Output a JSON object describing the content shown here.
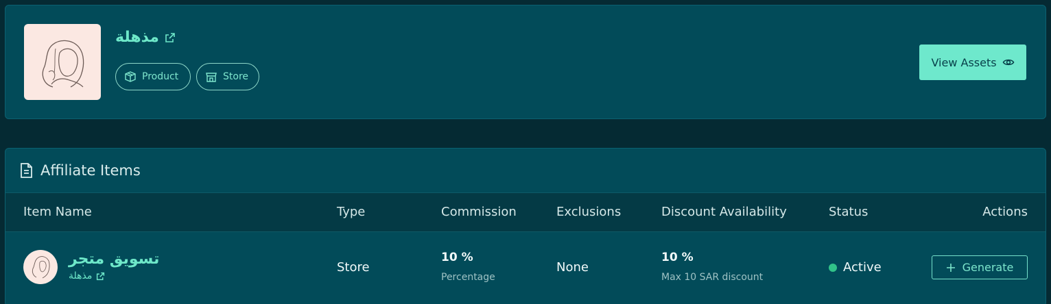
{
  "brand": {
    "name": "مذهلة",
    "tags": [
      "Product",
      "Store"
    ],
    "view_assets_label": "View Assets"
  },
  "affiliate_items": {
    "title": "Affiliate Items",
    "columns": [
      "Item Name",
      "Type",
      "Commission",
      "Exclusions",
      "Discount Availability",
      "Status",
      "Actions"
    ],
    "rows": [
      {
        "item_name": "تسويق متجر",
        "item_sub": "مذهلة",
        "type": "Store",
        "commission": "10 %",
        "commission_sub": "Percentage",
        "exclusions": "None",
        "discount": "10 %",
        "discount_sub": "Max 10 SAR discount",
        "status": "Active",
        "action_label": "Generate"
      }
    ]
  },
  "colors": {
    "background": "#052a33",
    "card": "#024b59",
    "accent": "#6ee8cc",
    "status_active": "#31c389"
  }
}
